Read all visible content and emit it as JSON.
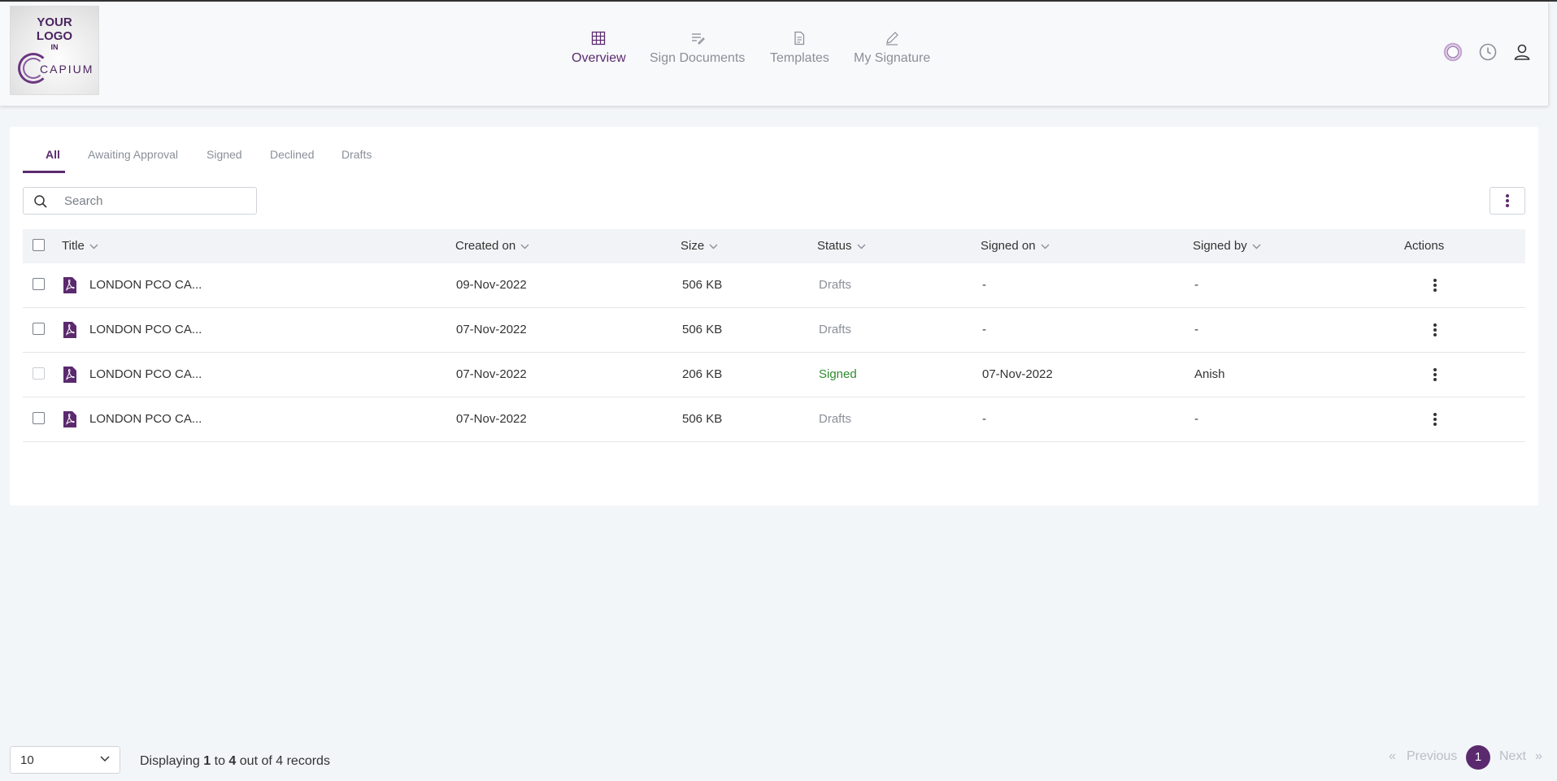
{
  "logo": {
    "line1": "YOUR",
    "line2": "LOGO",
    "line3": "IN",
    "brand": "CAPIUM"
  },
  "nav": {
    "items": [
      {
        "label": "Overview",
        "icon": "grid-icon",
        "active": true
      },
      {
        "label": "Sign Documents",
        "icon": "sign-documents-icon",
        "active": false
      },
      {
        "label": "Templates",
        "icon": "document-icon",
        "active": false
      },
      {
        "label": "My Signature",
        "icon": "pen-icon",
        "active": false
      }
    ]
  },
  "header_icons": [
    "capium-c-icon",
    "clock-icon",
    "user-icon"
  ],
  "tabs": [
    {
      "label": "All",
      "active": true
    },
    {
      "label": "Awaiting Approval",
      "active": false
    },
    {
      "label": "Signed",
      "active": false
    },
    {
      "label": "Declined",
      "active": false
    },
    {
      "label": "Drafts",
      "active": false
    }
  ],
  "search": {
    "placeholder": "Search",
    "value": ""
  },
  "table": {
    "columns": [
      "Title",
      "Created on",
      "Size",
      "Status",
      "Signed on",
      "Signed by",
      "Actions"
    ],
    "rows": [
      {
        "title": "LONDON PCO CA...",
        "created_on": "09-Nov-2022",
        "size": "506 KB",
        "status": "Drafts",
        "signed_on": "-",
        "signed_by": "-"
      },
      {
        "title": "LONDON PCO CA...",
        "created_on": "07-Nov-2022",
        "size": "506 KB",
        "status": "Drafts",
        "signed_on": "-",
        "signed_by": "-"
      },
      {
        "title": "LONDON PCO CA...",
        "created_on": "07-Nov-2022",
        "size": "206 KB",
        "status": "Signed",
        "signed_on": "07-Nov-2022",
        "signed_by": "Anish"
      },
      {
        "title": "LONDON PCO CA...",
        "created_on": "07-Nov-2022",
        "size": "506 KB",
        "status": "Drafts",
        "signed_on": "-",
        "signed_by": "-"
      }
    ]
  },
  "footer": {
    "page_size": "10",
    "displaying_prefix": "Displaying",
    "from": "1",
    "to_word": "to",
    "to": "4",
    "out_of": "out of 4 records",
    "previous": "Previous",
    "next": "Next",
    "prev_arrows": "«",
    "next_arrows": "»",
    "current_page": "1"
  },
  "colors": {
    "accent": "#5b2a6e",
    "signed": "#2e8b2e",
    "muted": "#8a8f98"
  }
}
